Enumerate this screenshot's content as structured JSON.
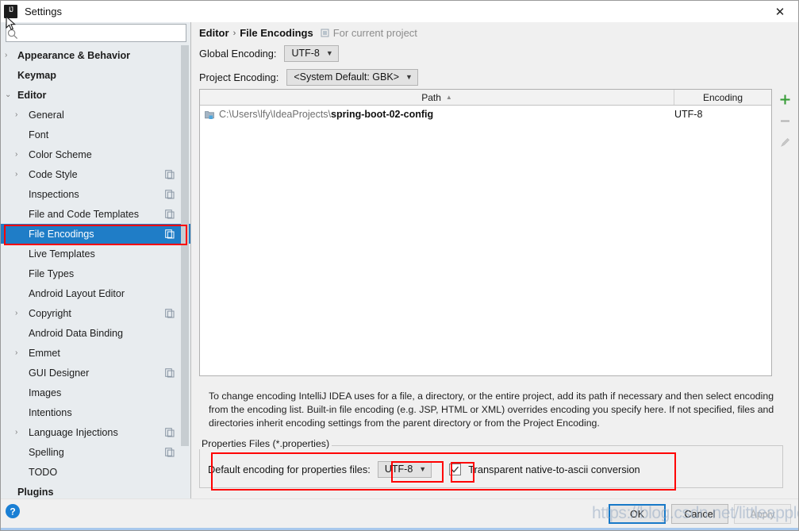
{
  "window": {
    "title": "Settings",
    "app_icon": "intellij-idea-icon",
    "close_label": "✕"
  },
  "sidebar": {
    "search": {
      "placeholder": "",
      "value": "",
      "icon": "search-icon"
    },
    "items": [
      {
        "label": "Appearance & Behavior",
        "level": 0,
        "arrow": "›",
        "has_copy": false,
        "selected": false
      },
      {
        "label": "Keymap",
        "level": 0,
        "arrow": "",
        "has_copy": false,
        "selected": false
      },
      {
        "label": "Editor",
        "level": 0,
        "arrow": "⌄",
        "has_copy": false,
        "selected": false
      },
      {
        "label": "General",
        "level": 1,
        "arrow": "›",
        "has_copy": false,
        "selected": false
      },
      {
        "label": "Font",
        "level": 1,
        "arrow": "",
        "has_copy": false,
        "selected": false
      },
      {
        "label": "Color Scheme",
        "level": 1,
        "arrow": "›",
        "has_copy": false,
        "selected": false
      },
      {
        "label": "Code Style",
        "level": 1,
        "arrow": "›",
        "has_copy": true,
        "selected": false
      },
      {
        "label": "Inspections",
        "level": 1,
        "arrow": "",
        "has_copy": true,
        "selected": false
      },
      {
        "label": "File and Code Templates",
        "level": 1,
        "arrow": "",
        "has_copy": true,
        "selected": false
      },
      {
        "label": "File Encodings",
        "level": 1,
        "arrow": "",
        "has_copy": true,
        "selected": true
      },
      {
        "label": "Live Templates",
        "level": 1,
        "arrow": "",
        "has_copy": false,
        "selected": false
      },
      {
        "label": "File Types",
        "level": 1,
        "arrow": "",
        "has_copy": false,
        "selected": false
      },
      {
        "label": "Android Layout Editor",
        "level": 1,
        "arrow": "",
        "has_copy": false,
        "selected": false
      },
      {
        "label": "Copyright",
        "level": 1,
        "arrow": "›",
        "has_copy": true,
        "selected": false
      },
      {
        "label": "Android Data Binding",
        "level": 1,
        "arrow": "",
        "has_copy": false,
        "selected": false
      },
      {
        "label": "Emmet",
        "level": 1,
        "arrow": "›",
        "has_copy": false,
        "selected": false
      },
      {
        "label": "GUI Designer",
        "level": 1,
        "arrow": "",
        "has_copy": true,
        "selected": false
      },
      {
        "label": "Images",
        "level": 1,
        "arrow": "",
        "has_copy": false,
        "selected": false
      },
      {
        "label": "Intentions",
        "level": 1,
        "arrow": "",
        "has_copy": false,
        "selected": false
      },
      {
        "label": "Language Injections",
        "level": 1,
        "arrow": "›",
        "has_copy": true,
        "selected": false
      },
      {
        "label": "Spelling",
        "level": 1,
        "arrow": "",
        "has_copy": true,
        "selected": false
      },
      {
        "label": "TODO",
        "level": 1,
        "arrow": "",
        "has_copy": false,
        "selected": false
      },
      {
        "label": "Plugins",
        "level": 0,
        "arrow": "",
        "has_copy": false,
        "selected": false
      }
    ]
  },
  "main": {
    "breadcrumb": {
      "parent": "Editor",
      "separator": "›",
      "current": "File Encodings",
      "scope": "For current project",
      "scope_icon": "project-scope-icon"
    },
    "global_encoding": {
      "label": "Global Encoding:",
      "value": "UTF-8"
    },
    "project_encoding": {
      "label": "Project Encoding:",
      "value": "<System Default: GBK>"
    },
    "table": {
      "columns": [
        "Path",
        "Encoding"
      ],
      "sort_column": "Path",
      "sort_arrow": "▲",
      "rows": [
        {
          "icon": "folder-module-icon",
          "path_dir": "C:\\Users\\lfy\\IdeaProjects\\",
          "path_name": "spring-boot-02-config",
          "encoding": "UTF-8"
        }
      ]
    },
    "tools": [
      {
        "name": "add-button",
        "glyph": "+",
        "enabled": true
      },
      {
        "name": "remove-button",
        "glyph": "−",
        "enabled": false
      },
      {
        "name": "edit-button",
        "glyph": "pencil",
        "enabled": false
      }
    ],
    "description": "To change encoding IntelliJ IDEA uses for a file, a directory, or the entire project, add its path if necessary and then select encoding from the encoding list. Built-in file encoding (e.g. JSP, HTML or XML) overrides encoding you specify here. If not specified, files and directories inherit encoding settings from the parent directory or from the Project Encoding.",
    "properties_group": {
      "title": "Properties Files (*.properties)",
      "default_encoding_label": "Default encoding for properties files:",
      "default_encoding_value": "UTF-8",
      "transparent_conversion_label": "Transparent native-to-ascii conversion",
      "transparent_conversion_checked": true
    }
  },
  "footer": {
    "help_icon": "help-question-icon",
    "buttons": [
      {
        "label": "OK",
        "style": "default"
      },
      {
        "label": "Cancel",
        "style": "normal"
      },
      {
        "label": "Apply",
        "style": "disabled"
      }
    ]
  },
  "overlay": {
    "watermark": "https://blog.csdn.net/littleapplegg",
    "annotation_color": "#ff0000"
  }
}
